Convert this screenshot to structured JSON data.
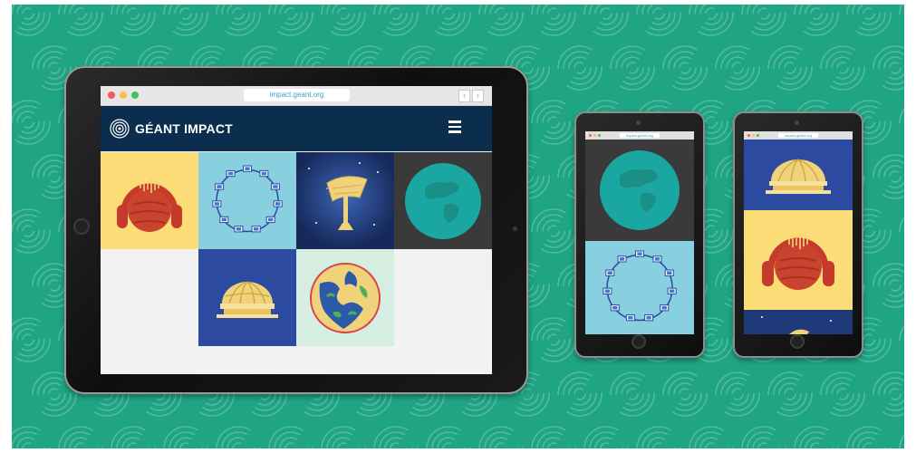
{
  "browser": {
    "url": "impact.geant.org",
    "back_glyph": "‹",
    "forward_glyph": "›"
  },
  "app": {
    "brand": "GÉANT IMPACT",
    "menu_icon": "hamburger-icon"
  },
  "phone1": {
    "url": "impact.geant.org"
  },
  "phone2": {
    "url": "impact.geant.org"
  },
  "colors": {
    "background": "#1fa484",
    "navbar": "#0b2e4f",
    "tile_yellow": "#fbdc77",
    "tile_lightblue": "#88cfdf",
    "tile_navy": "#1f3a78",
    "tile_royal": "#2c4aa0"
  },
  "tiles": [
    {
      "icon": "headphones-planet-icon"
    },
    {
      "icon": "network-ring-icon"
    },
    {
      "icon": "radio-telescope-icon"
    },
    {
      "icon": "earth-globe-icon"
    },
    {
      "icon": "dome-building-icon"
    },
    {
      "icon": "map-globe-icon"
    }
  ]
}
